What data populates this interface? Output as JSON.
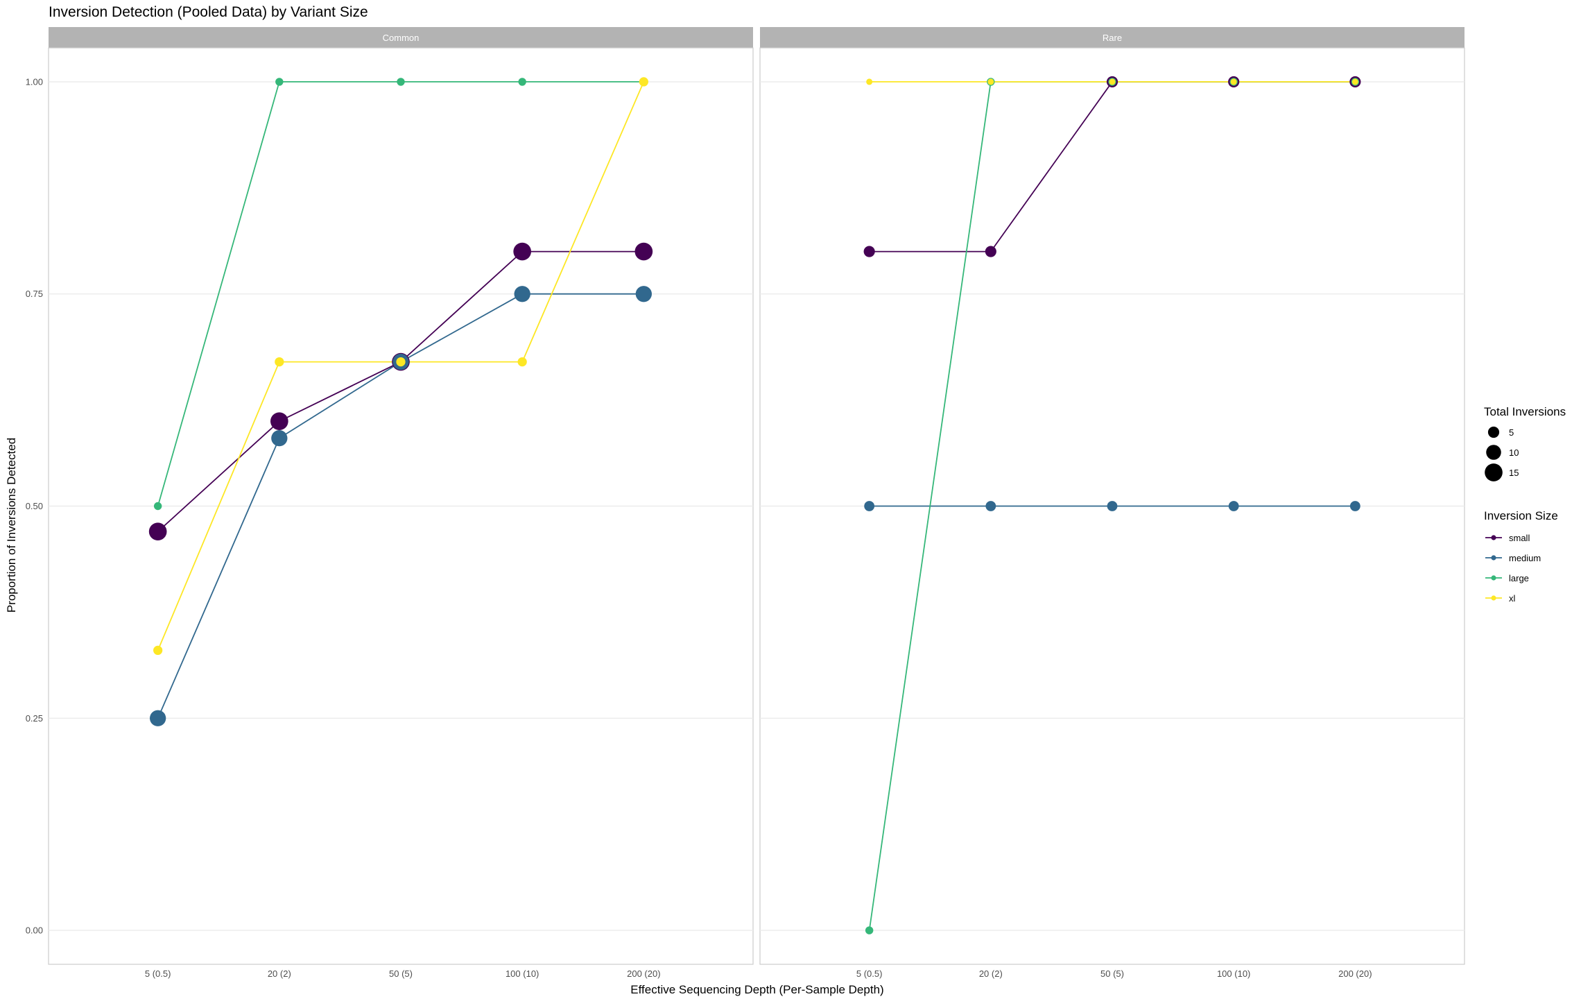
{
  "chart_data": {
    "type": "line",
    "title": "Inversion Detection (Pooled Data) by Variant Size",
    "xlabel": "Effective Sequencing Depth (Per-Sample Depth)",
    "ylabel": "Proportion of Inversions Detected",
    "categories": [
      "5 (0.5)",
      "20 (2)",
      "50 (5)",
      "100 (10)",
      "200 (20)"
    ],
    "ylim": [
      -0.04,
      1.04
    ],
    "yticks": [
      {
        "value": 0,
        "label": "0.00"
      },
      {
        "value": 0.25,
        "label": "0.25"
      },
      {
        "value": 0.5,
        "label": "0.50"
      },
      {
        "value": 0.75,
        "label": "0.75"
      },
      {
        "value": 1,
        "label": "1.00"
      }
    ],
    "grid": true,
    "legend_position": "right",
    "colors": {
      "small": "#440154",
      "medium": "#31688e",
      "large": "#35b779",
      "xl": "#fde725",
      "strip": "#b3b3b3",
      "grid": "#ebebeb",
      "border": "#cccccc"
    },
    "size_legend": {
      "title": "Total Inversions",
      "entries": [
        {
          "value": 5,
          "label": "5"
        },
        {
          "value": 10,
          "label": "10"
        },
        {
          "value": 15,
          "label": "15"
        }
      ]
    },
    "color_legend": {
      "title": "Inversion Size",
      "entries": [
        "small",
        "medium",
        "large",
        "xl"
      ]
    },
    "panels": [
      {
        "label": "Common",
        "series": [
          {
            "name": "small",
            "values": [
              0.47,
              0.6,
              0.67,
              0.8,
              0.8
            ],
            "totals": [
              15,
              15,
              15,
              15,
              15
            ]
          },
          {
            "name": "medium",
            "values": [
              0.25,
              0.58,
              0.67,
              0.75,
              0.75
            ],
            "totals": [
              12,
              12,
              12,
              12,
              12
            ]
          },
          {
            "name": "large",
            "values": [
              0.5,
              1.0,
              1.0,
              1.0,
              1.0
            ],
            "totals": [
              2,
              2,
              2,
              2,
              2
            ]
          },
          {
            "name": "xl",
            "values": [
              0.33,
              0.67,
              0.67,
              0.67,
              1.0
            ],
            "totals": [
              3,
              3,
              3,
              3,
              3
            ]
          }
        ]
      },
      {
        "label": "Rare",
        "series": [
          {
            "name": "small",
            "values": [
              0.8,
              0.8,
              1.0,
              1.0,
              1.0
            ],
            "totals": [
              5,
              5,
              5,
              5,
              5
            ]
          },
          {
            "name": "medium",
            "values": [
              0.5,
              0.5,
              0.5,
              0.5,
              0.5
            ],
            "totals": [
              4,
              4,
              4,
              4,
              4
            ]
          },
          {
            "name": "large",
            "values": [
              0.0,
              1.0,
              1.0,
              1.0,
              1.0
            ],
            "totals": [
              2,
              2,
              2,
              2,
              2
            ]
          },
          {
            "name": "xl",
            "values": [
              1.0,
              1.0,
              1.0,
              1.0,
              1.0
            ],
            "totals": [
              1,
              1,
              1,
              1,
              1
            ]
          }
        ]
      }
    ]
  }
}
